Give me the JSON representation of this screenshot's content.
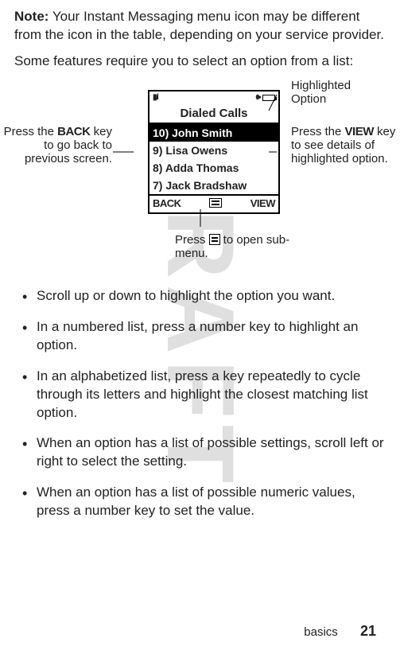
{
  "watermark": "DRAFT",
  "note_label": "Note:",
  "note_text": " Your Instant Messaging menu icon may be different from the icon in the table, depending on your service provider.",
  "some_text": "Some features require you to select an option from a list:",
  "diagram": {
    "screen_title": "Dialed Calls",
    "items": [
      "10) John Smith",
      "9)  Lisa Owens",
      "8)  Adda Thomas",
      "7) Jack Bradshaw"
    ],
    "soft_left": "BACK",
    "soft_right": "VIEW",
    "annot_left_pre": "Press the ",
    "annot_left_key": "BACK",
    "annot_left_post": " key to go back to previous screen.",
    "annot_highlight": "Highlighted Option",
    "annot_right_pre": "Press the ",
    "annot_right_key": "VIEW",
    "annot_right_post": " key to see details of highlighted option.",
    "annot_bottom_pre": "Press ",
    "annot_bottom_post": " to open sub-menu."
  },
  "bullets": [
    "Scroll up or down to highlight the option you want.",
    "In a numbered list, press a number key to highlight an option.",
    "In an alphabetized list, press a key repeatedly to cycle through its letters and highlight the closest matching list option.",
    "When an option has a list of possible settings, scroll left or right to select the setting.",
    "When an option has a list of possible numeric values, press a number key to set the value."
  ],
  "footer_section": "basics",
  "footer_page": "21"
}
